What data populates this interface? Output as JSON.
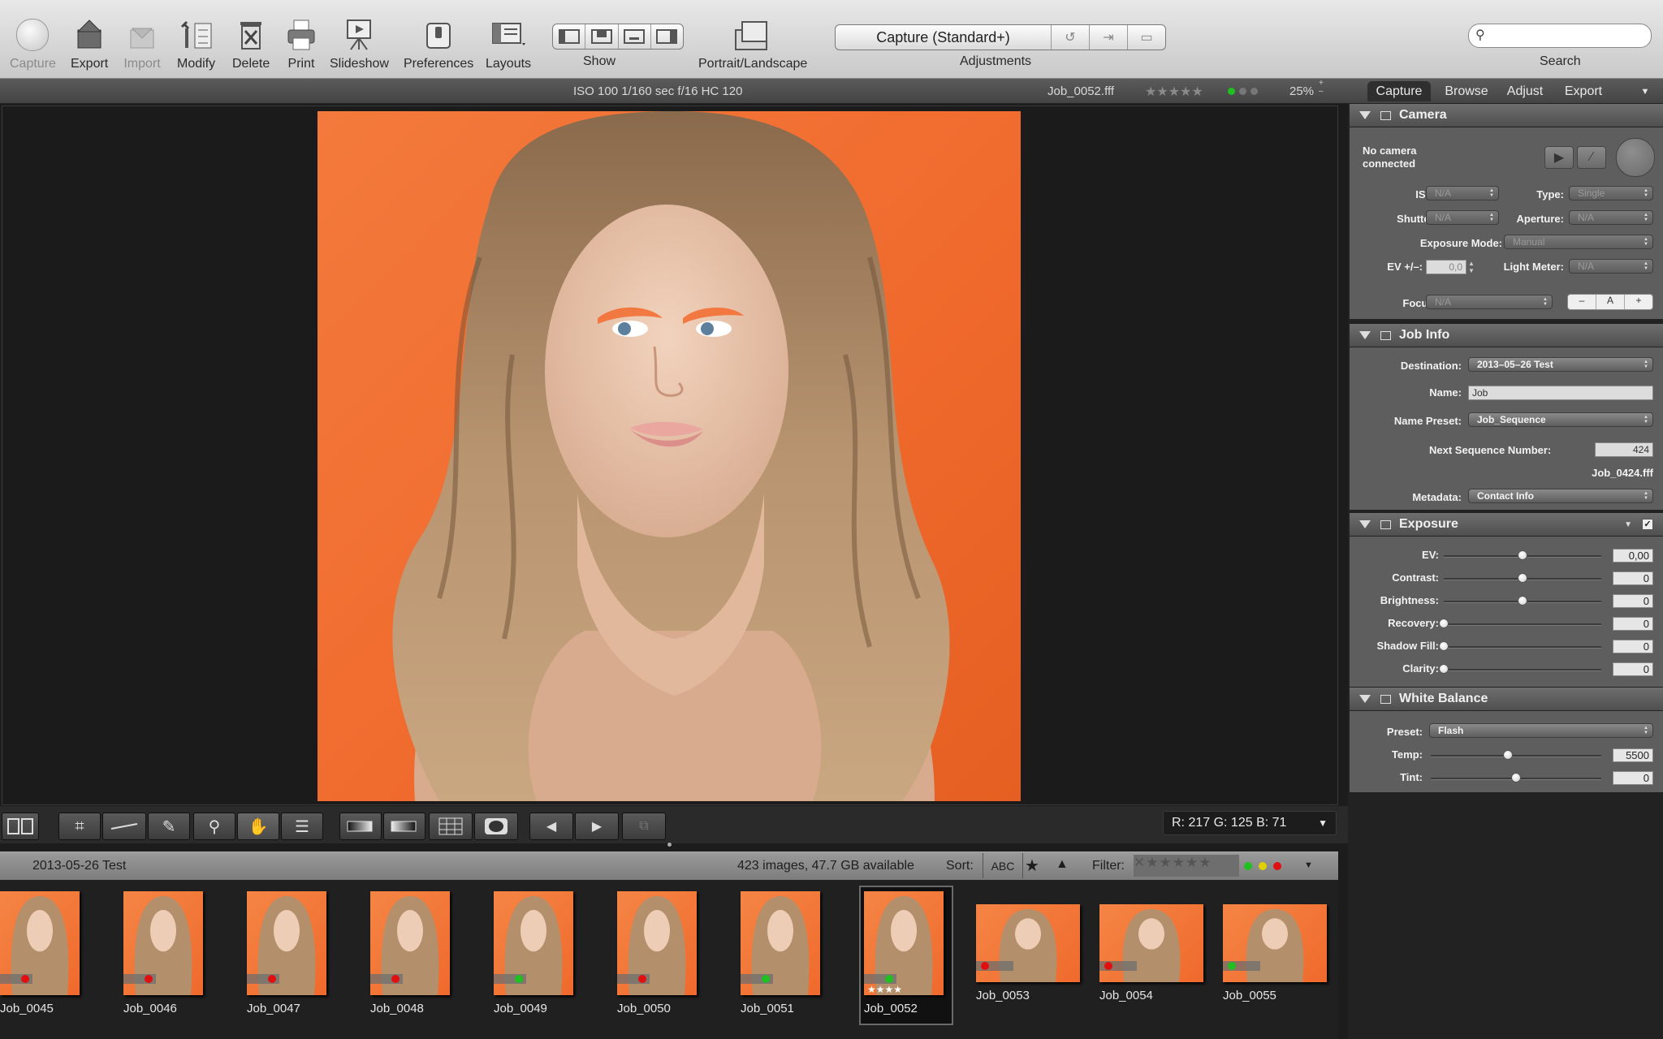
{
  "toolbar": {
    "capture": "Capture",
    "export": "Export",
    "import": "Import",
    "modify": "Modify",
    "delete": "Delete",
    "print": "Print",
    "slideshow": "Slideshow",
    "preferences": "Preferences",
    "layouts": "Layouts",
    "show": "Show",
    "portrait_landscape": "Portrait/Landscape",
    "adjustments": "Adjustments",
    "adjustments_value": "Capture (Standard+)",
    "search": "Search",
    "search_placeholder": ""
  },
  "infostrip": {
    "exposure": "ISO 100  1/160 sec  f/16  HC 120",
    "filename": "Job_0052.fff",
    "stars": "★★★★★",
    "zoom": "25%"
  },
  "rgb_readout": "R: 217  G: 125  B:  71",
  "browser": {
    "folder": "2013-05-26 Test",
    "status": "423 images, 47.7 GB available",
    "sort_label": "Sort:",
    "sort_abc": "ABC",
    "filter_label": "Filter:"
  },
  "thumbnails": [
    {
      "name": "Job_0045",
      "dot": "#e01010"
    },
    {
      "name": "Job_0046",
      "dot": "#e01010"
    },
    {
      "name": "Job_0047",
      "dot": "#e01010"
    },
    {
      "name": "Job_0048",
      "dot": "#e01010"
    },
    {
      "name": "Job_0049",
      "dot": "#20c020"
    },
    {
      "name": "Job_0050",
      "dot": "#e01010"
    },
    {
      "name": "Job_0051",
      "dot": "#20c020"
    },
    {
      "name": "Job_0052",
      "dot": "#20c020",
      "stars": "★★★★"
    },
    {
      "name": "Job_0053",
      "dot": "#e01010"
    },
    {
      "name": "Job_0054",
      "dot": "#e01010"
    },
    {
      "name": "Job_0055",
      "dot": "#20c020"
    }
  ],
  "panel": {
    "tabs": [
      "Capture",
      "Browse",
      "Adjust",
      "Export"
    ],
    "camera": {
      "title": "Camera",
      "status": "No camera\nconnected",
      "iso_label": "ISO:",
      "iso": "N/A",
      "type_label": "Type:",
      "type": "Single",
      "shutter_label": "Shutter:",
      "shutter": "N/A",
      "aperture_label": "Aperture:",
      "aperture": "N/A",
      "exposure_mode_label": "Exposure Mode:",
      "exposure_mode": "Manual",
      "ev_label": "EV +/–:",
      "ev": "0,0",
      "light_meter_label": "Light Meter:",
      "light_meter": "N/A",
      "focus_label": "Focus:",
      "focus": "N/A",
      "focus_minus": "–",
      "focus_a": "A",
      "focus_plus": "+"
    },
    "job_info": {
      "title": "Job Info",
      "destination_label": "Destination:",
      "destination": "2013–05–26 Test",
      "name_label": "Name:",
      "name": "Job",
      "name_preset_label": "Name Preset:",
      "name_preset": "Job_Sequence",
      "next_seq_label": "Next Sequence Number:",
      "next_seq": "424",
      "example": "Job_0424.fff",
      "metadata_label": "Metadata:",
      "metadata": "Contact Info"
    },
    "exposure": {
      "title": "Exposure",
      "sliders": [
        {
          "label": "EV:",
          "value": "0,00",
          "pos": 0.5
        },
        {
          "label": "Contrast:",
          "value": "0",
          "pos": 0.5
        },
        {
          "label": "Brightness:",
          "value": "0",
          "pos": 0.5
        },
        {
          "label": "Recovery:",
          "value": "0",
          "pos": 0.0
        },
        {
          "label": "Shadow Fill:",
          "value": "0",
          "pos": 0.0
        },
        {
          "label": "Clarity:",
          "value": "0",
          "pos": 0.0
        }
      ]
    },
    "white_balance": {
      "title": "White Balance",
      "preset_label": "Preset:",
      "preset": "Flash",
      "temp_label": "Temp:",
      "temp": "5500",
      "temp_pos": 0.45,
      "tint_label": "Tint:",
      "tint": "0",
      "tint_pos": 0.5
    }
  }
}
